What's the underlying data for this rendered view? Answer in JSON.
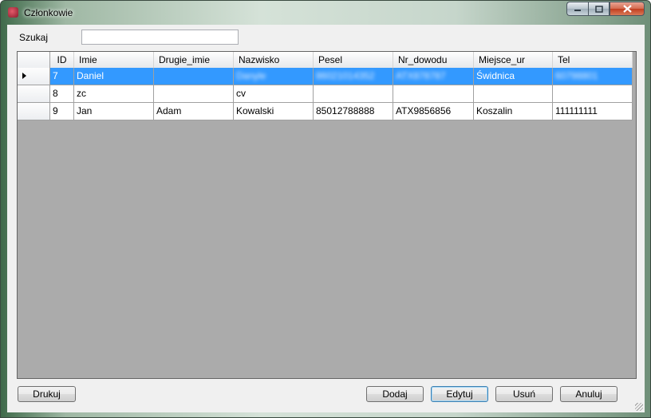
{
  "window": {
    "title": "Członkowie"
  },
  "search": {
    "label": "Szukaj",
    "value": ""
  },
  "grid": {
    "columns": [
      "ID",
      "Imie",
      "Drugie_imie",
      "Nazwisko",
      "Pesel",
      "Nr_dowodu",
      "Miejsce_ur",
      "Tel"
    ],
    "rows": [
      {
        "id": "7",
        "imie": "Daniel",
        "drugie": "",
        "nazwisko": "Danyle",
        "pesel": "86021014352",
        "nr": "ATX878787",
        "miejsce": "Świdnica",
        "tel": "60798801",
        "selected": true
      },
      {
        "id": "8",
        "imie": "zc",
        "drugie": "",
        "nazwisko": "cv",
        "pesel": "",
        "nr": "",
        "miejsce": "",
        "tel": ""
      },
      {
        "id": "9",
        "imie": "Jan",
        "drugie": "Adam",
        "nazwisko": "Kowalski",
        "pesel": "85012788888",
        "nr": "ATX9856856",
        "miejsce": "Koszalin",
        "tel": "111111111"
      }
    ]
  },
  "buttons": {
    "print": "Drukuj",
    "add": "Dodaj",
    "edit": "Edytuj",
    "delete": "Usuń",
    "cancel": "Anuluj"
  }
}
